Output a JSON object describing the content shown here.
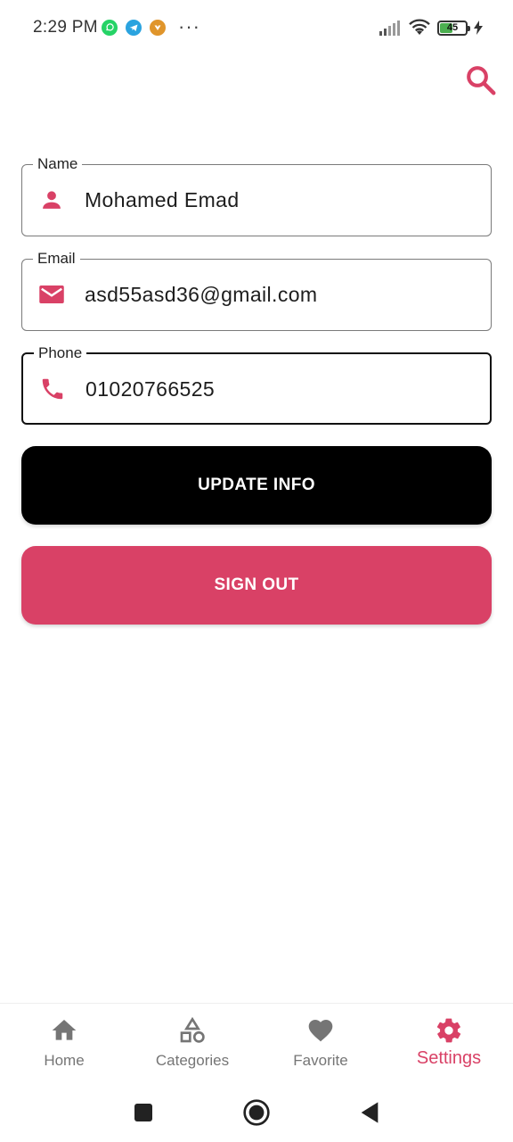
{
  "status_bar": {
    "time": "2:29 PM",
    "more": "···",
    "battery_level": "45",
    "notif_icons": [
      "whatsapp-icon",
      "telegram-icon",
      "app-notification-icon"
    ]
  },
  "colors": {
    "accent": "#d94166",
    "primary_button": "#000000",
    "nav_inactive": "#757575"
  },
  "form": {
    "name": {
      "label": "Name",
      "value": "Mohamed Emad",
      "icon": "person-icon"
    },
    "email": {
      "label": "Email",
      "value": "asd55asd36@gmail.com",
      "icon": "mail-icon"
    },
    "phone": {
      "label": "Phone",
      "value": "01020766525",
      "icon": "phone-icon"
    }
  },
  "buttons": {
    "update": "UPDATE INFO",
    "sign_out": "SIGN OUT"
  },
  "bottom_nav": {
    "active": "Settings",
    "items": [
      {
        "label": "Home",
        "icon": "home-icon"
      },
      {
        "label": "Categories",
        "icon": "category-icon"
      },
      {
        "label": "Favorite",
        "icon": "heart-icon"
      },
      {
        "label": "Settings",
        "icon": "gear-icon"
      }
    ]
  },
  "system_nav": [
    "recents-button",
    "home-button",
    "back-button"
  ]
}
